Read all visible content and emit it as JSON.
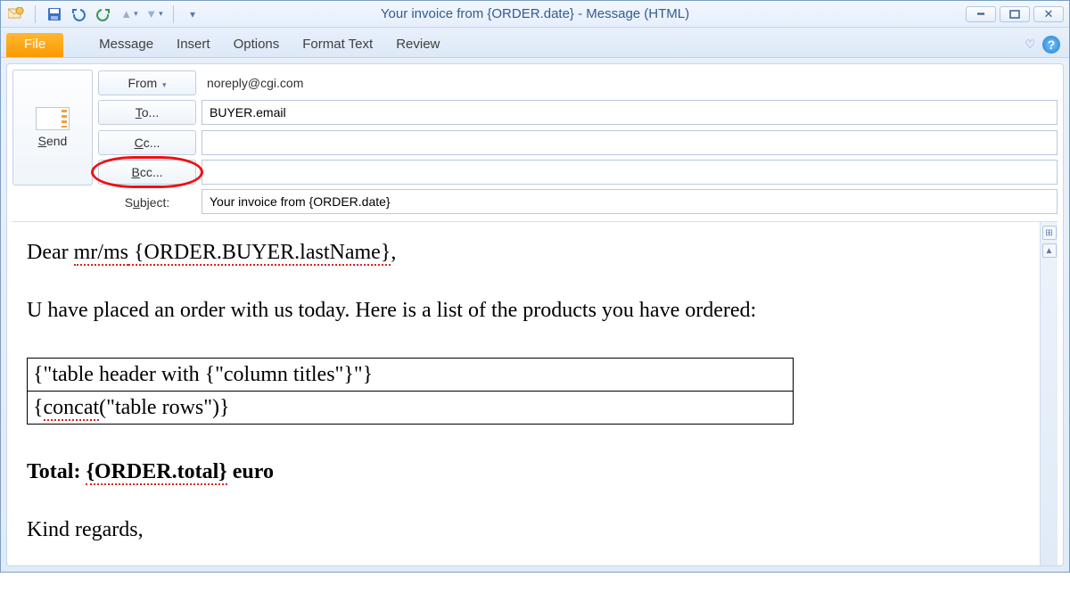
{
  "window_title": "Your invoice from {ORDER.date}  -  Message (HTML)",
  "qatools": {
    "save": "save",
    "undo": "undo",
    "redo": "redo"
  },
  "win_controls": {
    "min": "—",
    "max": "▣",
    "close": "✕"
  },
  "ribbon": {
    "file": "File",
    "tabs": [
      "Message",
      "Insert",
      "Options",
      "Format Text",
      "Review"
    ]
  },
  "compose": {
    "send_label": "Send",
    "from_label": "From",
    "from_value": "noreply@cgi.com",
    "to_label": "To...",
    "to_value": "BUYER.email",
    "cc_label": "Cc...",
    "cc_value": "",
    "bcc_label": "Bcc...",
    "bcc_value": "",
    "subject_label": "Subject:",
    "subject_value": "Your invoice from {ORDER.date}"
  },
  "body": {
    "greet_pre": "Dear ",
    "greet_mrms": "mr/ms",
    "greet_lastname": " {ORDER.BUYER.lastName}",
    "greet_comma": ",",
    "line2": "U have placed an order with us today. Here is a list of the products you have ordered:",
    "table_row1": "{\"table header with {\"column titles\"}\"}",
    "table_row2_a": "{",
    "table_row2_b": "concat",
    "table_row2_c": "(\"table rows\")}",
    "total_label": "Total: ",
    "total_value": "{ORDER.total}",
    "total_suffix": " euro",
    "signoff": "Kind regards,"
  }
}
